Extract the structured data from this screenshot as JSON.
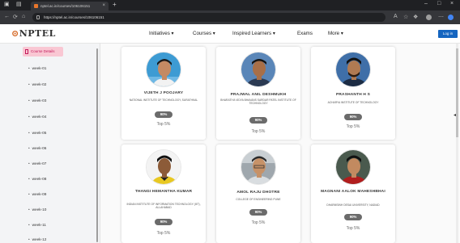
{
  "browser": {
    "tab_title": "nptel.ac.in/courses/106106151",
    "url": "https://nptel.ac.in/courses/106106151",
    "new_tab": "+",
    "close_tab": "×"
  },
  "header": {
    "logo_text": "NPTEL",
    "logo_mark": "⊙",
    "menu": [
      "Initiatives ▾",
      "Courses ▾",
      "Inspired Learners ▾",
      "Exams",
      "More ▾"
    ],
    "login": "Log in"
  },
  "sidebar": {
    "course_details": "Course Details",
    "weeks": [
      "week-01",
      "week-02",
      "week-03",
      "week-04",
      "week-05",
      "week-06",
      "week-07",
      "week-08",
      "week-09",
      "week-10",
      "week-11",
      "week-12"
    ]
  },
  "learners": [
    {
      "name": "VIJETH J POOJARY",
      "institute": "NATIONAL INSTITUTE OF TECHNOLOGY, SURATHKAL",
      "score": "90%",
      "rank": "Top 5%"
    },
    {
      "name": "PRAJWAL ANIL DESHMUKH",
      "institute": "BHARATIYA VIDYA BHAVANS SARDAR PATEL INSTITUTE OF TECHNOLOGY",
      "score": "90%",
      "rank": "Top 5%"
    },
    {
      "name": "PRASHANTH H S",
      "institute": "ACHARYA INSTITUTE OF TECHNOLOGY",
      "score": "90%",
      "rank": "Top 5%"
    },
    {
      "name": "THANGI HEMANTHA KUMAR",
      "institute": "INDIAN INSTITUTE OF INFORMATION TECHNOLOGY (IIIT), ALLAHABAD",
      "score": "90%",
      "rank": "Top 5%"
    },
    {
      "name": "AMOL RAJU DHOTRE",
      "institute": "COLLEGE OF ENGINEERING PUNE",
      "score": "90%",
      "rank": "Top 5%"
    },
    {
      "name": "MAGNANI AALOK MAHESHBHAI",
      "institute": "DHARMSINH DESAI UNIVERSITY, NADIAD",
      "score": "90%",
      "rank": "Top 5%"
    }
  ],
  "colors": {
    "accent": "#d4651f",
    "login": "#1565c0",
    "course_details_bg": "#f9c7d3",
    "badge": "#6b6b6b"
  }
}
